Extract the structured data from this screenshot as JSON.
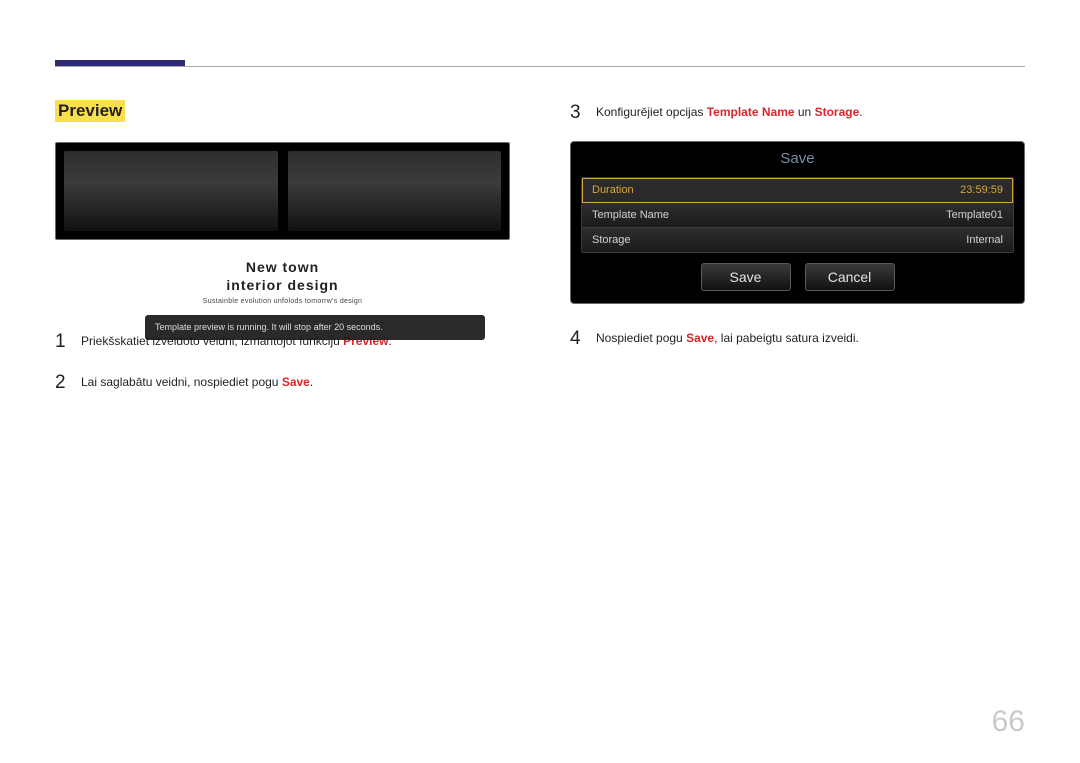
{
  "header": {
    "sectionTitle": "Preview"
  },
  "left": {
    "toast": "Template preview is running. It will stop after 20 seconds.",
    "captionLine1": "New town",
    "captionLine2": "interior design",
    "captionSub": "Sustainble evolution unfolods tomorrw's design",
    "steps": [
      {
        "num": "1",
        "pre": "Priekšskatiet izveidoto veidni, izmantojot funkciju ",
        "kw1": "Preview",
        "mid": ".",
        "kw2": "",
        "post": ""
      },
      {
        "num": "2",
        "pre": "Lai saglabātu veidni, nospiediet pogu ",
        "kw1": "Save",
        "mid": ".",
        "kw2": "",
        "post": ""
      }
    ]
  },
  "right": {
    "steps": [
      {
        "num": "3",
        "pre": "Konfigurējiet opcijas ",
        "kw1": "Template Name",
        "mid": " un ",
        "kw2": "Storage",
        "post": "."
      },
      {
        "num": "4",
        "pre": "Nospiediet pogu ",
        "kw1": "Save",
        "mid": ", lai pabeigtu satura izveidi.",
        "kw2": "",
        "post": ""
      }
    ],
    "dialog": {
      "title": "Save",
      "rows": [
        {
          "label": "Duration",
          "value": "23:59:59",
          "selected": true
        },
        {
          "label": "Template Name",
          "value": "Template01",
          "selected": false
        },
        {
          "label": "Storage",
          "value": "Internal",
          "selected": false
        }
      ],
      "saveBtn": "Save",
      "cancelBtn": "Cancel"
    }
  },
  "pageNumber": "66"
}
